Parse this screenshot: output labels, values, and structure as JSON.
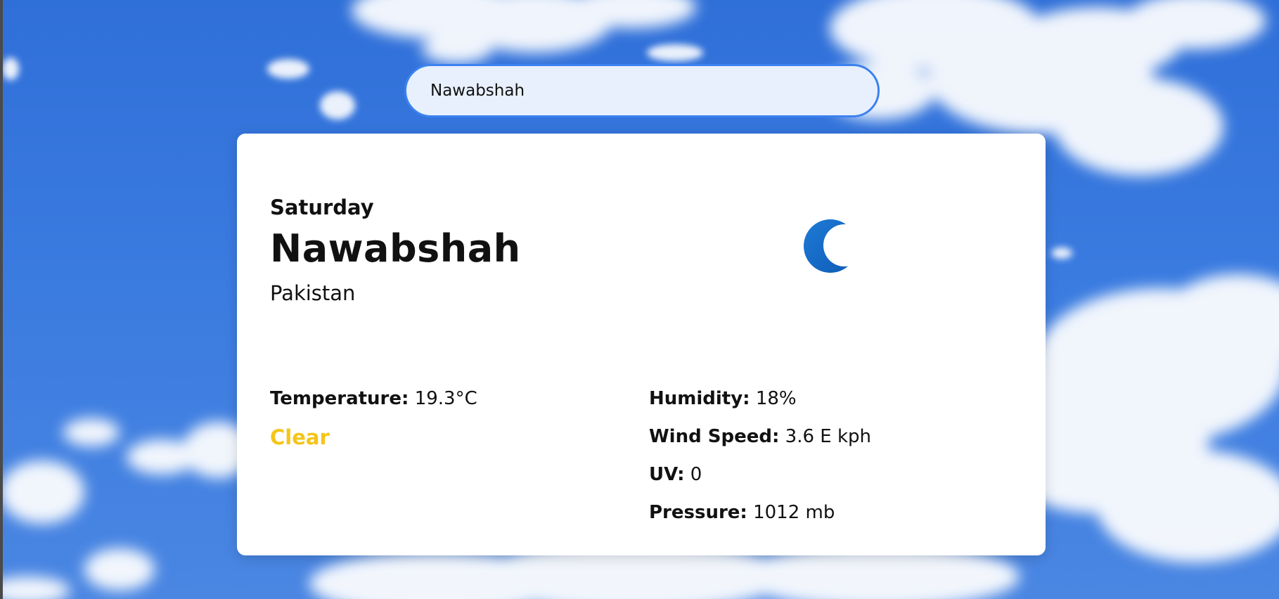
{
  "search": {
    "value": "Nawabshah"
  },
  "weather": {
    "day": "Saturday",
    "city": "Nawabshah",
    "country": "Pakistan",
    "icon": "crescent-moon-icon",
    "condition": "Clear",
    "condition_color": "#f5c518",
    "temperature_label": "Temperature:",
    "temperature_value": "19.3°C",
    "humidity_label": "Humidity:",
    "humidity_value": "18%",
    "wind_label": "Wind Speed:",
    "wind_value": "3.6 E kph",
    "uv_label": "UV:",
    "uv_value": "0",
    "pressure_label": "Pressure:",
    "pressure_value": "1012 mb"
  },
  "colors": {
    "sky": "#3a7be0",
    "search_border": "#3b82f0",
    "search_bg": "#e8f0fd",
    "moon": "#1565c0"
  }
}
